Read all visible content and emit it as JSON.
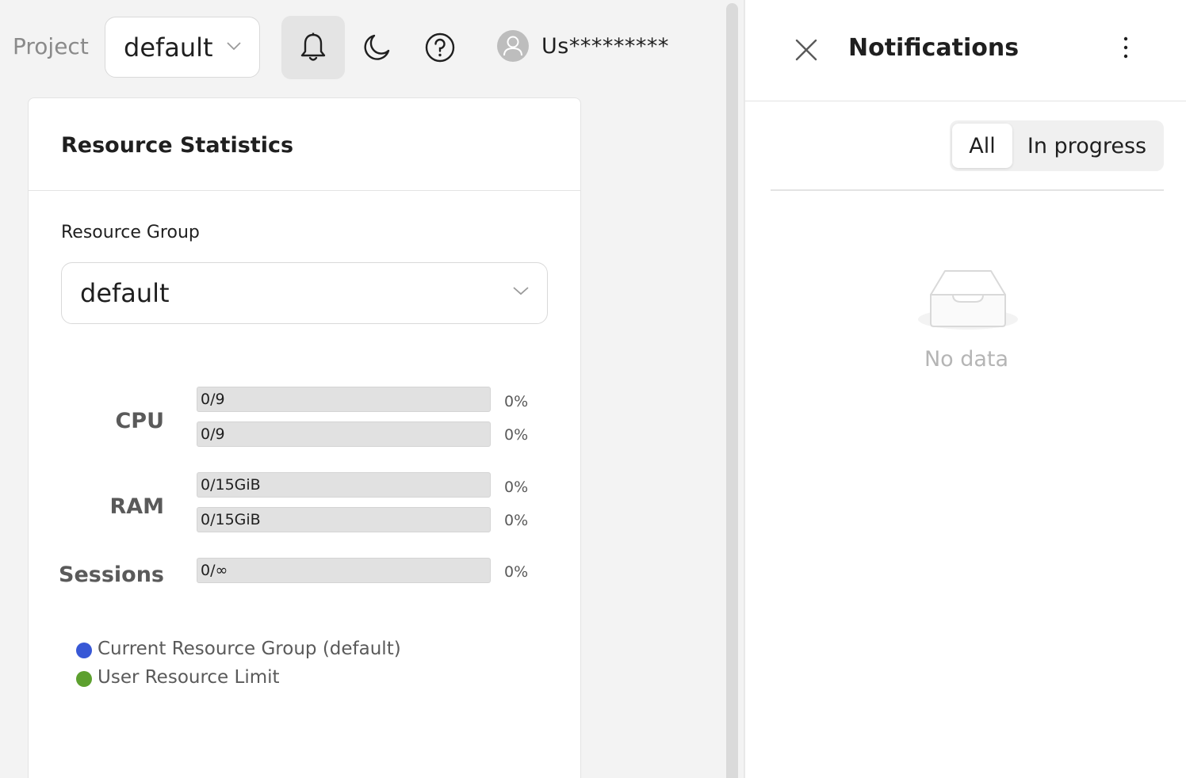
{
  "header": {
    "project_label": "Project",
    "project_value": "default",
    "icons": [
      "chevron-down-icon",
      "bell-icon",
      "moon-icon",
      "help-icon",
      "user-icon"
    ],
    "username": "Us*********"
  },
  "resource_card": {
    "title": "Resource Statistics",
    "resource_group_label": "Resource Group",
    "resource_group_value": "default",
    "stats": [
      {
        "label": "CPU",
        "bars": [
          {
            "text": "0/9",
            "percent": "0%",
            "fill_fraction": 0
          },
          {
            "text": "0/9",
            "percent": "0%",
            "fill_fraction": 0
          }
        ]
      },
      {
        "label": "RAM",
        "bars": [
          {
            "text": "0/15GiB",
            "percent": "0%",
            "fill_fraction": 0
          },
          {
            "text": "0/15GiB",
            "percent": "0%",
            "fill_fraction": 0
          }
        ]
      },
      {
        "label": "Sessions",
        "bars": [
          {
            "text": "0/∞",
            "percent": "0%",
            "fill_fraction": 0
          }
        ]
      }
    ],
    "legend": [
      {
        "label": "Current Resource Group (default)",
        "color": "#3858d6"
      },
      {
        "label": "User Resource Limit",
        "color": "#5da02f"
      }
    ]
  },
  "notifications": {
    "title": "Notifications",
    "tabs": [
      {
        "label": "All",
        "active": true
      },
      {
        "label": "In progress",
        "active": false
      }
    ],
    "empty_text": "No data",
    "icons": [
      "close-icon",
      "more-vertical-icon",
      "empty-inbox-icon"
    ]
  }
}
